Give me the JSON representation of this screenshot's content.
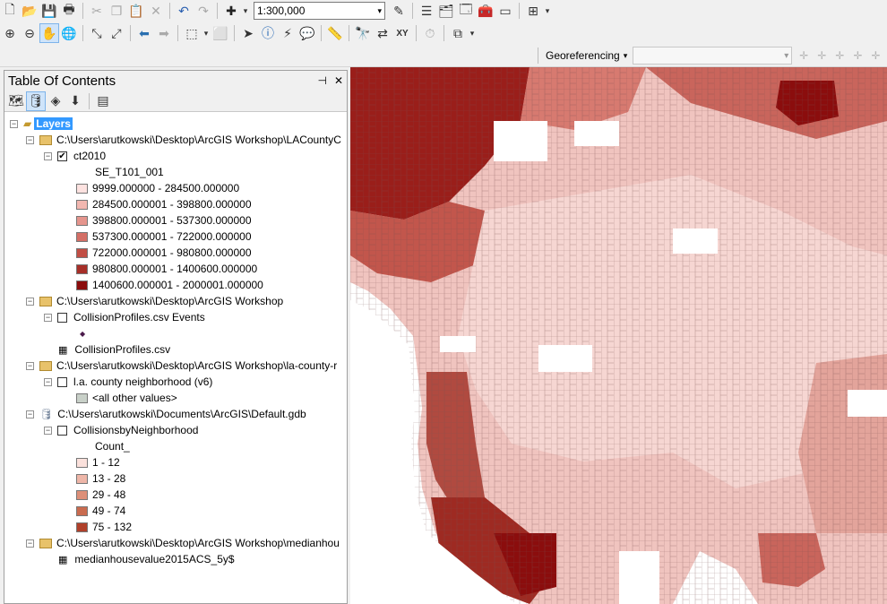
{
  "toolbar": {
    "scale_value": "1:300,000",
    "georeferencing_label": "Georeferencing"
  },
  "toc": {
    "title": "Table Of Contents",
    "root": "Layers",
    "group1_path": "C:\\Users\\arutkowski\\Desktop\\ArcGIS Workshop\\LACountyC",
    "layer1_name": "ct2010",
    "layer1_field": "SE_T101_001",
    "layer1_classes": [
      {
        "label": "9999.000000 - 284500.000000",
        "color": "#fde2e0"
      },
      {
        "label": "284500.000001 - 398800.000000",
        "color": "#f2b7b0"
      },
      {
        "label": "398800.000001 - 537300.000000",
        "color": "#e5958d"
      },
      {
        "label": "537300.000001 - 722000.000000",
        "color": "#d46f66"
      },
      {
        "label": "722000.000001 - 980800.000000",
        "color": "#c14e45"
      },
      {
        "label": "980800.000001 - 1400600.000000",
        "color": "#a72f28"
      },
      {
        "label": "1400600.000001 - 2000001.000000",
        "color": "#8b0d0d"
      }
    ],
    "group2_path": "C:\\Users\\arutkowski\\Desktop\\ArcGIS Workshop",
    "layer2_name": "CollisionProfiles.csv Events",
    "table2_name": "CollisionProfiles.csv",
    "group3_path": "C:\\Users\\arutkowski\\Desktop\\ArcGIS Workshop\\la-county-r",
    "layer3_name": "l.a. county neighborhood (v6)",
    "layer3_other": "<all other values>",
    "group4_path": "C:\\Users\\arutkowski\\Documents\\ArcGIS\\Default.gdb",
    "layer4_name": "CollisionsbyNeighborhood",
    "layer4_field": "Count_",
    "layer4_classes": [
      {
        "label": "1 - 12",
        "color": "#fbe1dc"
      },
      {
        "label": "13 - 28",
        "color": "#eeb6a8"
      },
      {
        "label": "29 - 48",
        "color": "#dd8f78"
      },
      {
        "label": "49 - 74",
        "color": "#c96b4f"
      },
      {
        "label": "75 - 132",
        "color": "#b0402a"
      }
    ],
    "group5_path": "C:\\Users\\arutkowski\\Desktop\\ArcGIS Workshop\\medianhou",
    "table5_name": "medianhousevalue2015ACS_5y$"
  }
}
